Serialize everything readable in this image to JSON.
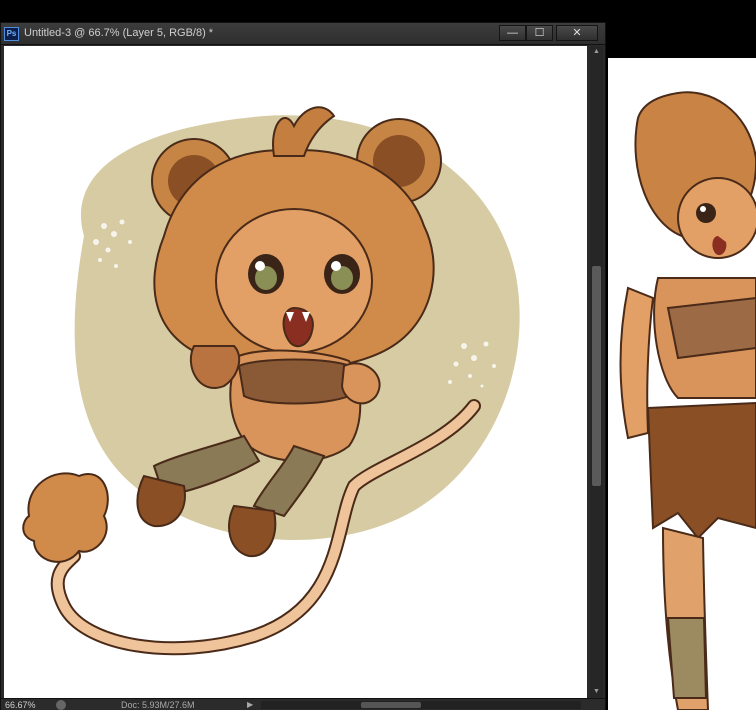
{
  "window": {
    "app_icon": "Ps",
    "title": "Untitled-3 @ 66.7% (Layer 5, RGB/8) *",
    "controls": {
      "minimize": "—",
      "maximize": "☐",
      "close": "✕"
    }
  },
  "status": {
    "zoom": "66.67%",
    "doc_size": "Doc: 5.93M/27.6M"
  },
  "colors": {
    "accent_ps": "#4f8de0",
    "circle_bg": "#cfc293",
    "fur": "#d08b4a",
    "fur_dark": "#8a4f24",
    "line": "#4a2a18"
  }
}
